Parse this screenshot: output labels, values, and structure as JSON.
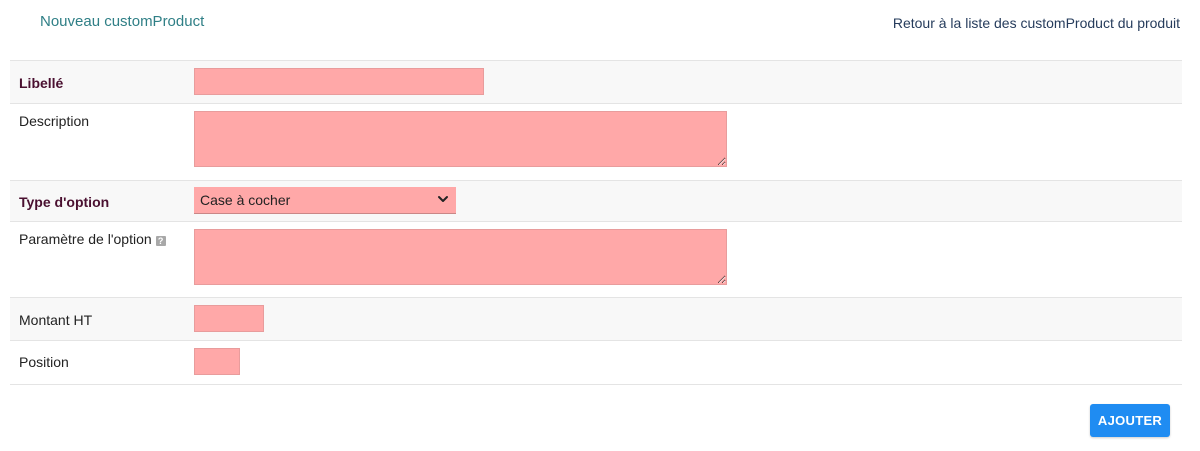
{
  "header": {
    "title": "Nouveau customProduct",
    "back_link": "Retour à la liste des customProduct du produit"
  },
  "form": {
    "libelle": {
      "label": "Libellé",
      "value": ""
    },
    "description": {
      "label": "Description",
      "value": ""
    },
    "type_option": {
      "label": "Type d'option",
      "selected": "Case à cocher"
    },
    "parametre": {
      "label": "Paramètre de l'option",
      "help_icon": "help-icon",
      "help_glyph": "?",
      "value": ""
    },
    "montant_ht": {
      "label": "Montant HT",
      "value": ""
    },
    "position": {
      "label": "Position",
      "value": ""
    }
  },
  "actions": {
    "submit_label": "AJOUTER"
  },
  "colors": {
    "title": "#2f7f86",
    "required_label": "#4a1030",
    "field_bg": "#ffa8a8",
    "submit_bg": "#1f8cf2"
  }
}
